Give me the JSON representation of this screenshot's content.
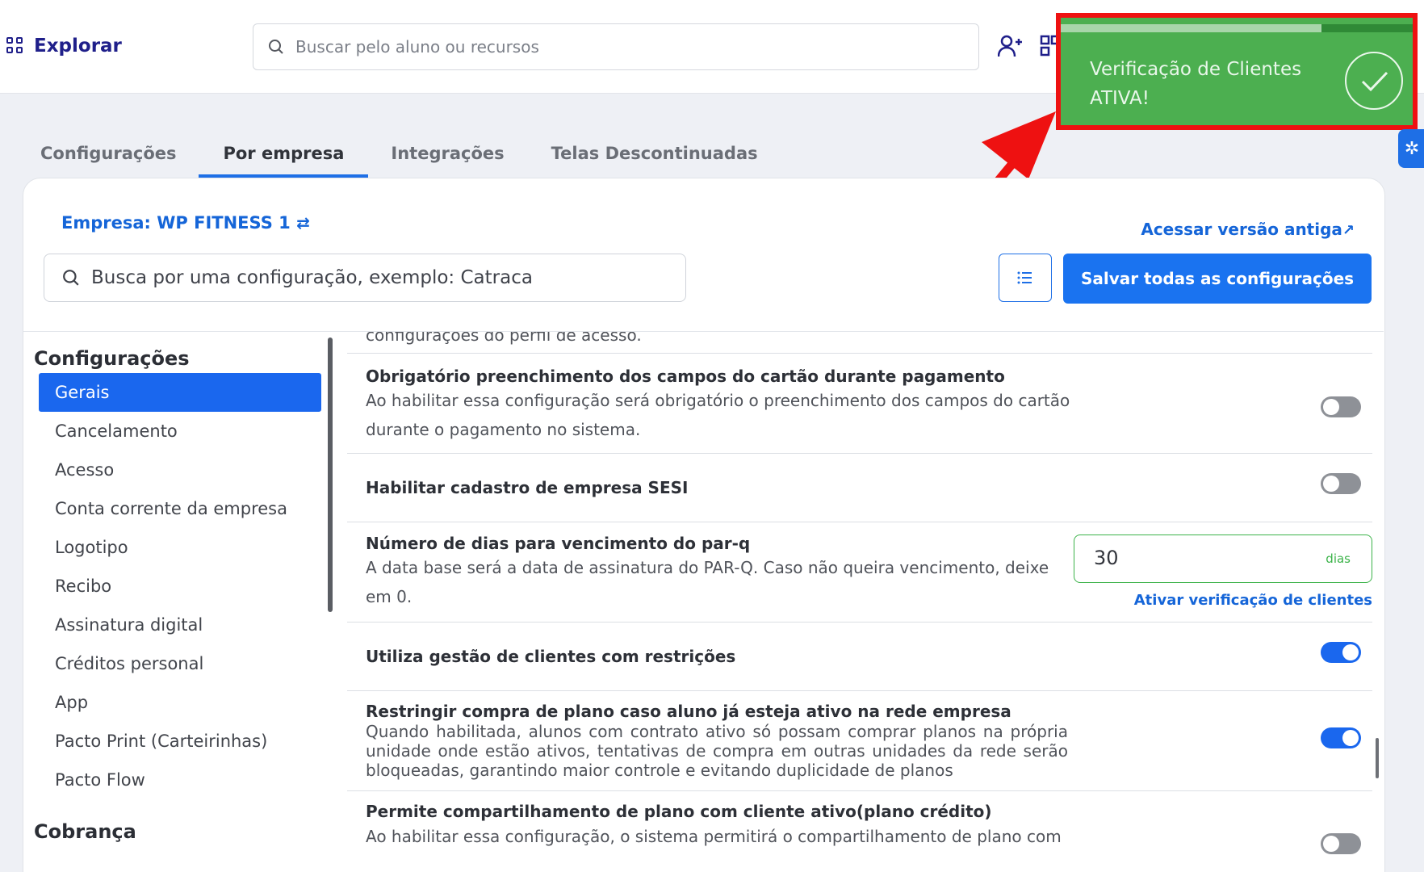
{
  "header": {
    "brand": "Explorar",
    "search_placeholder": "Buscar pelo aluno ou recursos"
  },
  "toast": {
    "message": "Verificação de Clientes ATIVA!",
    "color": "#4caf50",
    "highlight_color": "#ee1111",
    "progress": 0.74
  },
  "tabs": [
    {
      "label": "Configurações",
      "active": false
    },
    {
      "label": "Por empresa",
      "active": true
    },
    {
      "label": "Integrações",
      "active": false
    },
    {
      "label": "Telas Descontinuadas",
      "active": false
    }
  ],
  "page": {
    "company": "Empresa: WP FITNESS 1",
    "old_version_link": "Acessar versão antiga",
    "search_placeholder": "Busca por uma configuração, exemplo: Catraca",
    "save_all_label": "Salvar todas as configurações",
    "accent": "#1a67ee"
  },
  "sidebar": {
    "section_1": "Configurações",
    "items": [
      {
        "label": "Gerais",
        "active": true
      },
      {
        "label": "Cancelamento"
      },
      {
        "label": "Acesso"
      },
      {
        "label": "Conta corrente da empresa"
      },
      {
        "label": "Logotipo"
      },
      {
        "label": "Recibo"
      },
      {
        "label": "Assinatura digital"
      },
      {
        "label": "Créditos personal"
      },
      {
        "label": "App"
      },
      {
        "label": "Pacto Print (Carteirinhas)"
      },
      {
        "label": "Pacto Flow"
      }
    ],
    "section_2": "Cobrança"
  },
  "settings": {
    "cut_text": "configurações do perfil de acesso.",
    "row1": {
      "title": "Obrigatório preenchimento dos campos do cartão durante pagamento",
      "desc_1": "Ao habilitar essa configuração será obrigatório o preenchimento dos campos do cartão",
      "desc_2": "durante o pagamento no sistema.",
      "enabled": false
    },
    "row2": {
      "title": "Habilitar cadastro de empresa SESI",
      "enabled": false
    },
    "row3": {
      "title": "Número de dias para vencimento do par-q",
      "desc_1": "A data base será a data de assinatura do PAR-Q. Caso não queira vencimento, deixe",
      "desc_2": "em 0.",
      "value": "30",
      "unit": "dias",
      "link": "Ativar verificação de clientes"
    },
    "row4": {
      "title": "Utiliza gestão de clientes com restrições",
      "enabled": true
    },
    "row5": {
      "title": "Restringir compra de plano caso aluno já esteja ativo na rede empresa",
      "desc": "Quando habilitada, alunos com contrato ativo só possam comprar planos na própria unidade onde estão ativos, tentativas de compra em outras unidades da rede serão bloqueadas, garantindo maior controle e evitando duplicidade de planos",
      "enabled": true
    },
    "row6": {
      "title": "Permite compartilhamento de plano com cliente ativo(plano crédito)",
      "desc_1": "Ao habilitar essa configuração, o sistema permitirá o compartilhamento de plano com",
      "enabled": false
    }
  }
}
